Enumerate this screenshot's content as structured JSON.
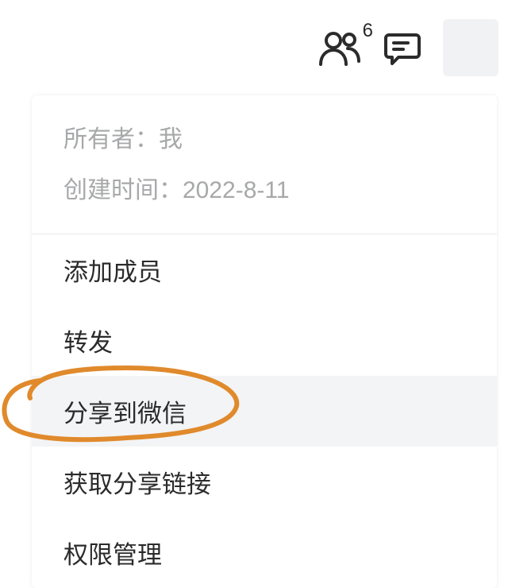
{
  "header": {
    "badge_count": "6"
  },
  "info": {
    "owner_label": "所有者：",
    "owner_value": "我",
    "created_label": "创建时间：",
    "created_value": "2022-8-11"
  },
  "menu": {
    "items": [
      {
        "label": "添加成员"
      },
      {
        "label": "转发"
      },
      {
        "label": "分享到微信"
      },
      {
        "label": "获取分享链接"
      },
      {
        "label": "权限管理"
      }
    ],
    "highlighted_index": 2
  },
  "colors": {
    "annotation": "#e08a2c"
  }
}
